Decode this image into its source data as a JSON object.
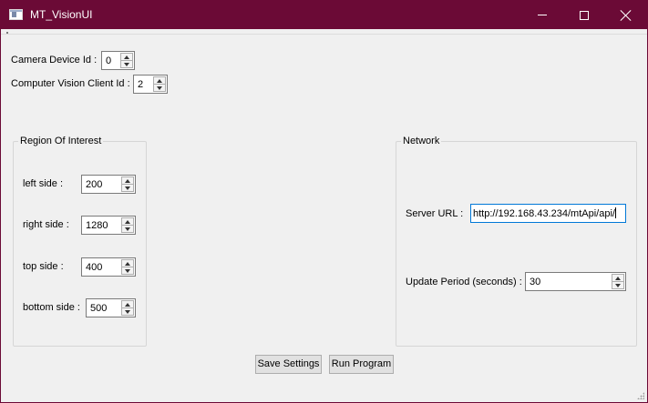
{
  "window": {
    "title": "MT_VisionUI",
    "accent_color": "#6b0a36",
    "icons": {
      "app": "app-window-icon",
      "minimize": "minimize-icon",
      "maximize": "maximize-icon",
      "close": "close-icon"
    }
  },
  "top_fields": {
    "camera_label": "Camera Device Id :",
    "camera_value": "0",
    "cv_client_label": "Computer Vision Client Id :",
    "cv_client_value": "2"
  },
  "roi": {
    "title": "Region Of Interest",
    "left_label": "left side :",
    "left_value": "200",
    "right_label": "right side :",
    "right_value": "1280",
    "top_label": "top side :",
    "top_value": "400",
    "bottom_label": "bottom side :",
    "bottom_value": "500"
  },
  "network": {
    "title": "Network",
    "server_label": "Server URL :",
    "server_value": "http://192.168.43.234/mtApi/api/",
    "period_label": "Update Period (seconds) :",
    "period_value": "30"
  },
  "buttons": {
    "save": "Save Settings",
    "run": "Run Program"
  }
}
